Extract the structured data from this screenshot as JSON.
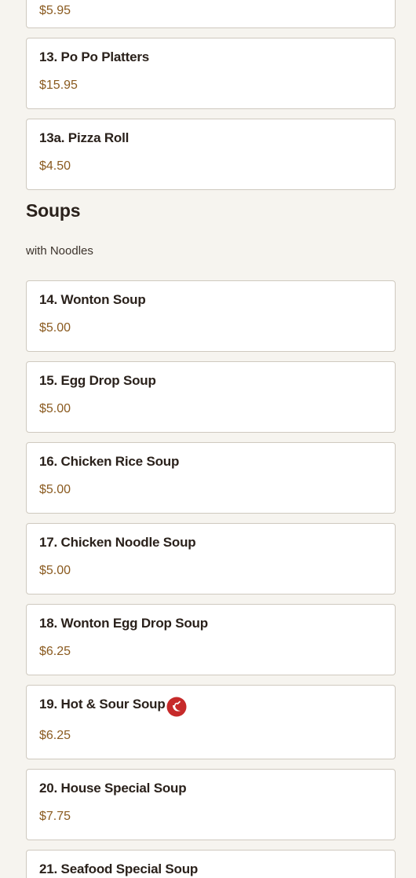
{
  "colors": {
    "background": "#f6f4ef",
    "card_border": "#cfc9bf",
    "price": "#8a5a1f",
    "spicy_icon": "#c62a2a"
  },
  "previous_item": {
    "price": "$5.95"
  },
  "appetizers": [
    {
      "name": "13. Po Po Platters",
      "price": "$15.95"
    },
    {
      "name": "13a. Pizza Roll",
      "price": "$4.50"
    }
  ],
  "soups": {
    "title": "Soups",
    "description": "with Noodles",
    "items": [
      {
        "name": "14. Wonton Soup",
        "price": "$5.00"
      },
      {
        "name": "15. Egg Drop Soup",
        "price": "$5.00"
      },
      {
        "name": "16. Chicken Rice Soup",
        "price": "$5.00"
      },
      {
        "name": "17. Chicken Noodle Soup",
        "price": "$5.00"
      },
      {
        "name": "18. Wonton Egg Drop Soup",
        "price": "$6.25"
      },
      {
        "name": "19. Hot & Sour Soup",
        "price": "$6.25",
        "icon": "spicy-pepper-icon"
      },
      {
        "name": "20. House Special Soup",
        "price": "$7.75"
      },
      {
        "name": "21. Seafood Special Soup"
      }
    ]
  }
}
